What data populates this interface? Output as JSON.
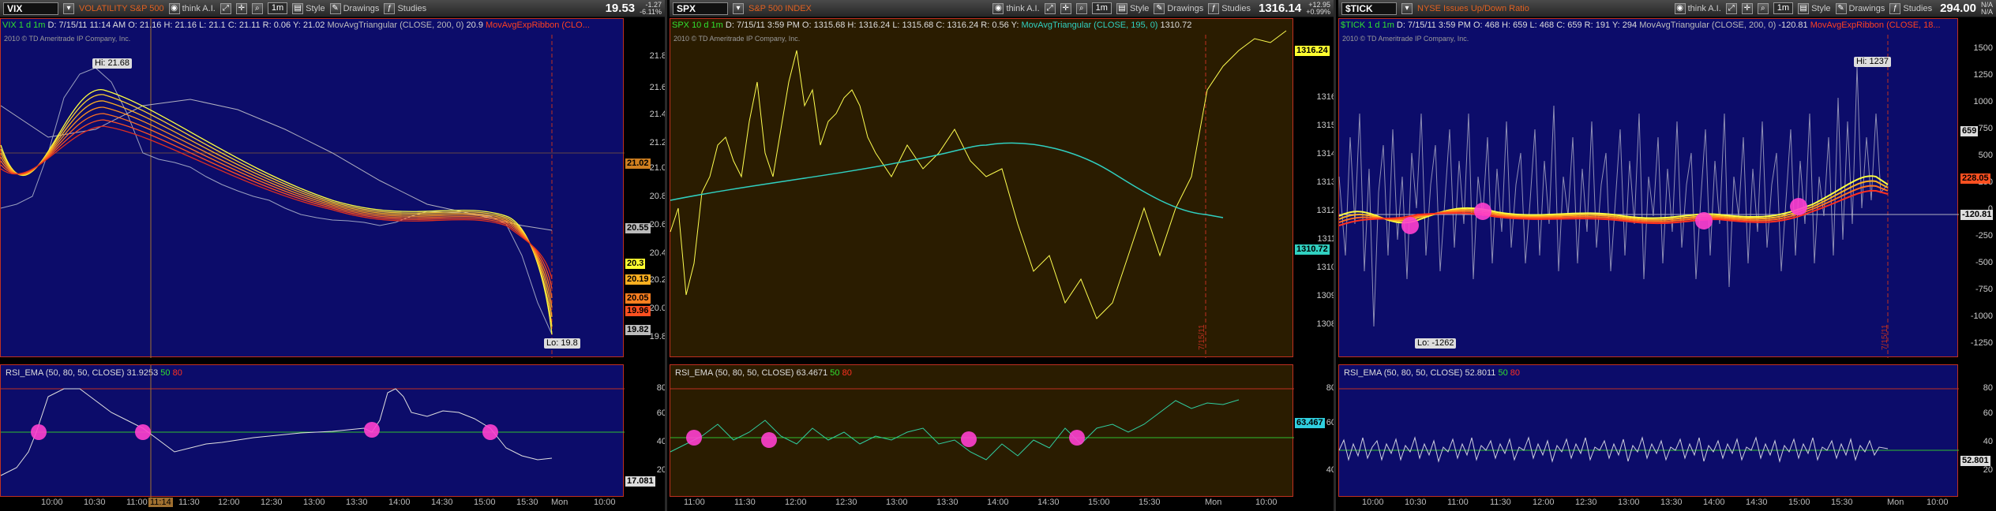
{
  "panels": [
    {
      "key": "vix",
      "toolbar": {
        "symbol": "VIX",
        "description": "VOLATILITY S&P 500",
        "app": "think A.I.",
        "timeframe": "1m",
        "style": "Style",
        "drawings": "Drawings",
        "studies": "Studies",
        "last": "19.53",
        "chg1": "-1.27",
        "chg2": "-6.11%"
      },
      "info": {
        "name": "VIX 1 d 1m",
        "d": "D: 7/15/11 11:14 AM",
        "o": "O: 21.16",
        "h": "H: 21.16",
        "l": "L: 21.1",
        "c": "C: 21.11",
        "r": "R: 0.06",
        "y": "Y: 21.02",
        "study": "MovAvgTriangular (CLOSE, 200, 0)",
        "study_val": "20.9",
        "ribbon": "MovAvgExpRibbon (CLO..."
      },
      "copyright": "2010 © TD Ameritrade IP Company, Inc.",
      "hi_label": "Hi: 21.68",
      "lo_label": "Lo: 19.8",
      "yaxis": [
        "21.8",
        "21.6",
        "21.4",
        "21.2",
        "21.0",
        "20.8",
        "20.6",
        "20.4",
        "20.2",
        "20.0",
        "19.8"
      ],
      "tags": [
        "21.02",
        "20.55",
        "20.3",
        "20.19",
        "20.05",
        "19.96",
        "19.82"
      ],
      "tag_colors": [
        "#d08020",
        "#bbbbbb",
        "#ffff30",
        "#ffb020",
        "#ff8020",
        "#ff5020",
        "#bbbbbb"
      ],
      "rsi": {
        "label": "RSI_EMA (50, 80, 50, CLOSE)",
        "value": "31.9253",
        "mid": "50",
        "upper": "80",
        "yaxis": [
          "80",
          "60",
          "40",
          "20"
        ],
        "tag": "17.081"
      },
      "xaxis": [
        "10:00",
        "10:30",
        "11:00",
        "11:14",
        "11:30",
        "12:00",
        "12:30",
        "13:00",
        "13:30",
        "14:00",
        "14:30",
        "15:00",
        "15:30",
        "Mon",
        "10:00"
      ],
      "vdate": ""
    },
    {
      "key": "spx",
      "toolbar": {
        "symbol": "SPX",
        "description": "S&P 500 INDEX",
        "app": "think A.I.",
        "timeframe": "1m",
        "style": "Style",
        "drawings": "Drawings",
        "studies": "Studies",
        "last": "1316.14",
        "chg1": "+12.95",
        "chg2": "+0.99%"
      },
      "info": {
        "name": "SPX 10 d 1m",
        "d": "D: 7/15/11 3:59 PM",
        "o": "O: 1315.68",
        "h": "H: 1316.24",
        "l": "L: 1315.68",
        "c": "C: 1316.24",
        "r": "R: 0.56",
        "y": "Y:",
        "study": "MovAvgTriangular (CLOSE, 195, 0)",
        "study_val": "1310.72",
        "ribbon": ""
      },
      "copyright": "2010 © TD Ameritrade IP Company, Inc.",
      "hi_label": "",
      "lo_label": "",
      "yaxis": [
        "1316",
        "1315",
        "1314",
        "1313",
        "1312",
        "1311",
        "1310",
        "1309",
        "1308"
      ],
      "tags": [
        "1316.24",
        "1310.72"
      ],
      "tag_colors": [
        "#ffff30",
        "#30d0c0"
      ],
      "rsi": {
        "label": "RSI_EMA (50, 80, 50, CLOSE)",
        "value": "63.4671",
        "mid": "50",
        "upper": "80",
        "yaxis": [
          "80",
          "60",
          "40"
        ],
        "tag": "63.467"
      },
      "xaxis": [
        "11:00",
        "11:30",
        "12:00",
        "12:30",
        "13:00",
        "13:30",
        "14:00",
        "14:30",
        "15:00",
        "15:30",
        "Mon",
        "10:00"
      ],
      "vdate": "7/15/11"
    },
    {
      "key": "tick",
      "toolbar": {
        "symbol": "$TICK",
        "description": "NYSE Issues Up/Down Ratio",
        "app": "think A.I.",
        "timeframe": "1m",
        "style": "Style",
        "drawings": "Drawings",
        "studies": "Studies",
        "last": "294.00",
        "chg1": "N/A",
        "chg2": "N/A"
      },
      "info": {
        "name": "$TICK 1 d 1m",
        "d": "D: 7/15/11 3:59 PM",
        "o": "O: 468",
        "h": "H: 659",
        "l": "L: 468",
        "c": "C: 659",
        "r": "R: 191",
        "y": "Y: 294",
        "study": "MovAvgTriangular (CLOSE, 200, 0)",
        "study_val": "-120.81",
        "ribbon": "MovAvgExpRibbon (CLOSE, 18..."
      },
      "copyright": "2010 © TD Ameritrade IP Company, Inc.",
      "hi_label": "Hi: 1237",
      "lo_label": "Lo: -1262",
      "yaxis": [
        "1500",
        "1250",
        "1000",
        "750",
        "500",
        "250",
        "0",
        "-250",
        "-500",
        "-750",
        "-1000",
        "-1250"
      ],
      "tags": [
        "659",
        "228.05",
        "-120.81"
      ],
      "tag_colors": [
        "#dddddd",
        "#ff5020",
        "#dddddd"
      ],
      "rsi": {
        "label": "RSI_EMA (50, 80, 50, CLOSE)",
        "value": "52.8011",
        "mid": "50",
        "upper": "80",
        "yaxis": [
          "80",
          "60",
          "40",
          "20"
        ],
        "tag": "52.801"
      },
      "xaxis": [
        "10:00",
        "10:30",
        "11:00",
        "11:30",
        "12:00",
        "12:30",
        "13:00",
        "13:30",
        "14:00",
        "14:30",
        "15:00",
        "15:30",
        "Mon",
        "10:00"
      ],
      "vdate": "7/15/11"
    }
  ]
}
